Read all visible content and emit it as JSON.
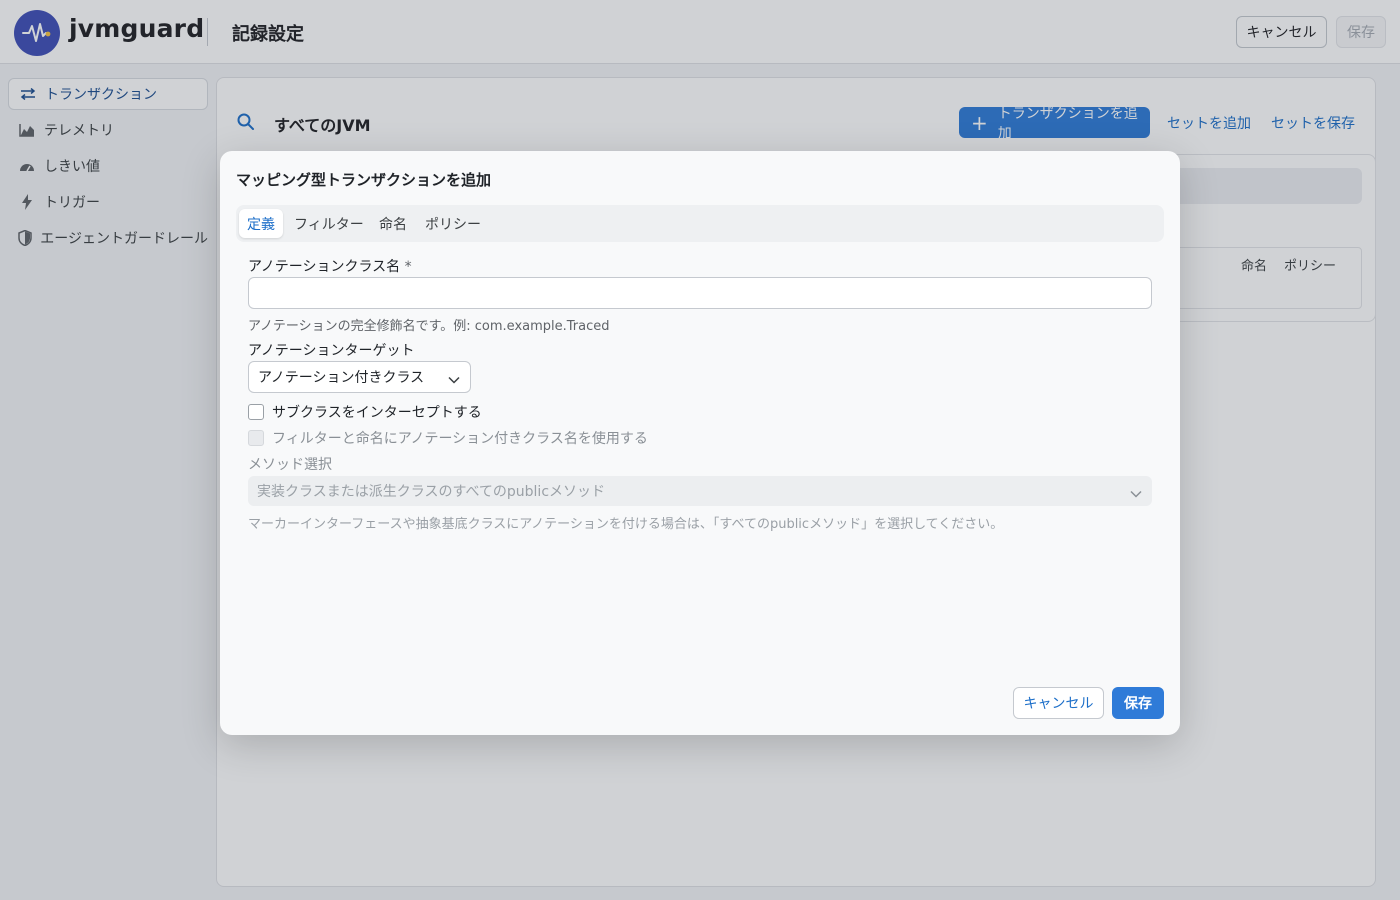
{
  "header": {
    "brand": "jvmguard",
    "title": "記録設定",
    "cancel_label": "キャンセル",
    "save_label": "保存"
  },
  "sidebar": {
    "items": [
      {
        "label": "トランザクション",
        "icon": "transactions-icon",
        "active": true
      },
      {
        "label": "テレメトリ",
        "icon": "chart-icon",
        "active": false
      },
      {
        "label": "しきい値",
        "icon": "gauge-icon",
        "active": false
      },
      {
        "label": "トリガー",
        "icon": "lightning-icon",
        "active": false
      },
      {
        "label": "エージェントガードレール",
        "icon": "shield-icon",
        "active": false
      }
    ]
  },
  "main": {
    "scope_title": "すべてのJVM",
    "add_transaction_label": "トランザクションを追加",
    "add_set_label": "セットを追加",
    "save_set_label": "セットを保存",
    "columns": [
      "命名",
      "ポリシー"
    ]
  },
  "modal": {
    "title": "マッピング型トランザクションを追加",
    "tabs": [
      "定義",
      "フィルター",
      "命名",
      "ポリシー"
    ],
    "active_tab": "定義",
    "annotation_class_label": "アノテーションクラス名",
    "required_mark": "*",
    "annotation_class_value": "",
    "annotation_class_help": "アノテーションの完全修飾名です。例: com.example.Traced",
    "target_label": "アノテーションターゲット",
    "target_value": "アノテーション付きクラス",
    "intercept_subclasses_label": "サブクラスをインターセプトする",
    "use_class_name_label": "フィルターと命名にアノテーション付きクラス名を使用する",
    "method_selection_label": "メソッド選択",
    "method_selection_value": "実装クラスまたは派生クラスのすべてのpublicメソッド",
    "method_selection_help": "マーカーインターフェースや抽象基底クラスにアノテーションを付ける場合は、「すべてのpublicメソッド」を選択してください。",
    "cancel_label": "キャンセル",
    "save_label": "保存"
  },
  "colors": {
    "primary": "#2f7bd8",
    "link": "#1d6fc9",
    "logo": "#3f4fb8"
  }
}
